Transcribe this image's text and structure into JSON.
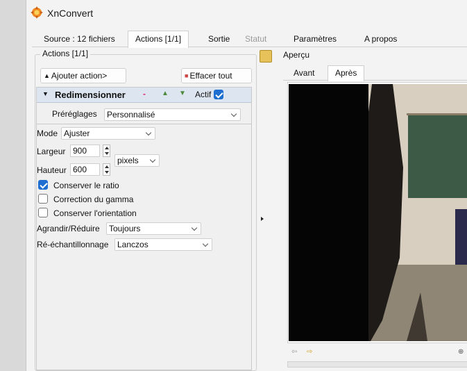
{
  "app": {
    "title": "XnConvert"
  },
  "tabs": [
    {
      "label": "Source : 12 fichiers",
      "active": false,
      "disabled": false
    },
    {
      "label": "Actions [1/1]",
      "active": true,
      "disabled": false
    },
    {
      "label": "Sortie",
      "active": false,
      "disabled": false
    },
    {
      "label": "Statut",
      "active": false,
      "disabled": true
    },
    {
      "label": "Paramètres",
      "active": false,
      "disabled": false
    },
    {
      "label": "A propos",
      "active": false,
      "disabled": false
    }
  ],
  "actions": {
    "group_label": "Actions [1/1]",
    "add_button": "Ajouter action>",
    "clear_button": "Effacer tout",
    "action": {
      "title": "Redimensionner",
      "active_label": "Actif",
      "active": true,
      "presets_label": "Préréglages",
      "presets_value": "Personnalisé",
      "mode_label": "Mode",
      "mode_value": "Ajuster",
      "width_label": "Largeur",
      "width_value": "900",
      "height_label": "Hauteur",
      "height_value": "600",
      "unit_value": "pixels",
      "keep_ratio_label": "Conserver le ratio",
      "keep_ratio": true,
      "gamma_label": "Correction du gamma",
      "gamma": false,
      "orientation_label": "Conserver l'orientation",
      "orientation": false,
      "enlarge_label": "Agrandir/Réduire",
      "enlarge_value": "Toujours",
      "resample_label": "Ré-échantillonnage",
      "resample_value": "Lanczos"
    }
  },
  "preview": {
    "label": "Aperçu",
    "tabs": [
      {
        "label": "Avant",
        "active": false
      },
      {
        "label": "Après",
        "active": true
      }
    ]
  },
  "colors": {
    "accent": "#1f6fd1",
    "header_bg": "#dde6f0",
    "chalkboard": "#3c5a45"
  }
}
